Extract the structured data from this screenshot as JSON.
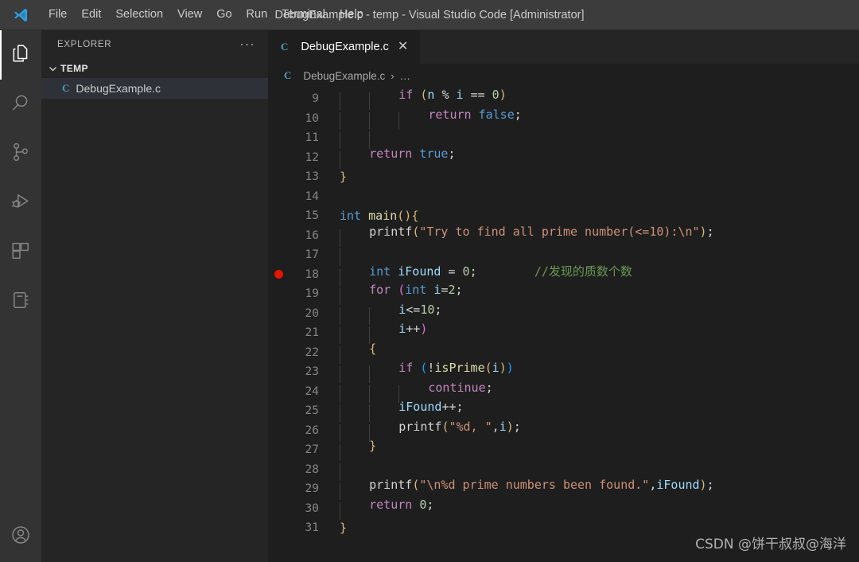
{
  "titlebar": {
    "logo_icon": "vscode-logo-icon",
    "window_title": "DebugExample.c - temp - Visual Studio Code [Administrator]",
    "menu": [
      {
        "label": "File"
      },
      {
        "label": "Edit"
      },
      {
        "label": "Selection"
      },
      {
        "label": "View"
      },
      {
        "label": "Go"
      },
      {
        "label": "Run"
      },
      {
        "label": "Terminal"
      },
      {
        "label": "Help"
      }
    ]
  },
  "activitybar": {
    "items": [
      {
        "icon": "files-explorer-icon",
        "label": "Explorer",
        "active": true
      },
      {
        "icon": "search-icon",
        "label": "Search",
        "active": false
      },
      {
        "icon": "source-control-icon",
        "label": "Source Control",
        "active": false
      },
      {
        "icon": "run-and-debug-icon",
        "label": "Run and Debug",
        "active": false
      },
      {
        "icon": "extensions-icon",
        "label": "Extensions",
        "active": false
      },
      {
        "icon": "notebook-icon",
        "label": "Notebook",
        "active": false
      }
    ],
    "bottom": [
      {
        "icon": "account-icon",
        "label": "Accounts"
      }
    ]
  },
  "sidebar": {
    "title": "EXPLORER",
    "more_actions": "···",
    "folder": {
      "label": "TEMP",
      "expanded": true
    },
    "files": [
      {
        "icon": "c-file-icon",
        "label": "DebugExample.c",
        "selected": true
      }
    ]
  },
  "editor": {
    "tabs": [
      {
        "icon": "c-file-icon",
        "label": "DebugExample.c",
        "close": "✕",
        "active": true
      }
    ],
    "breadcrumb": {
      "file_icon": "c-file-icon",
      "file": "DebugExample.c",
      "separator": "›",
      "overflow": "…"
    }
  },
  "code": {
    "first_visible_line": 9,
    "breakpoint_line": 18,
    "lines": [
      {
        "n": 9,
        "indent": 2,
        "tokens": [
          {
            "t": "if",
            "c": "t-key"
          },
          {
            "t": " ",
            "c": "t-plain"
          },
          {
            "t": "(",
            "c": "p-y"
          },
          {
            "t": "n",
            "c": "t-var"
          },
          {
            "t": " ",
            "c": "t-plain"
          },
          {
            "t": "%",
            "c": "t-plain"
          },
          {
            "t": " ",
            "c": "t-plain"
          },
          {
            "t": "i",
            "c": "t-var"
          },
          {
            "t": " ",
            "c": "t-plain"
          },
          {
            "t": "==",
            "c": "t-plain"
          },
          {
            "t": " ",
            "c": "t-plain"
          },
          {
            "t": "0",
            "c": "t-num"
          },
          {
            "t": ")",
            "c": "p-y"
          }
        ]
      },
      {
        "n": 10,
        "indent": 3,
        "tokens": [
          {
            "t": "return",
            "c": "t-key"
          },
          {
            "t": " ",
            "c": "t-plain"
          },
          {
            "t": "false",
            "c": "t-const"
          },
          {
            "t": ";",
            "c": "t-plain"
          }
        ]
      },
      {
        "n": 11,
        "indent": 2,
        "tokens": []
      },
      {
        "n": 12,
        "indent": 1,
        "tokens": [
          {
            "t": "return",
            "c": "t-key"
          },
          {
            "t": " ",
            "c": "t-plain"
          },
          {
            "t": "true",
            "c": "t-const"
          },
          {
            "t": ";",
            "c": "t-plain"
          }
        ]
      },
      {
        "n": 13,
        "indent": 0,
        "tokens": [
          {
            "t": "}",
            "c": "br-y"
          }
        ]
      },
      {
        "n": 14,
        "indent": 0,
        "tokens": []
      },
      {
        "n": 15,
        "indent": 0,
        "tokens": [
          {
            "t": "int",
            "c": "t-type"
          },
          {
            "t": " ",
            "c": "t-plain"
          },
          {
            "t": "main",
            "c": "t-fn"
          },
          {
            "t": "(",
            "c": "p-y"
          },
          {
            "t": ")",
            "c": "p-y"
          },
          {
            "t": "{",
            "c": "br-y"
          }
        ]
      },
      {
        "n": 16,
        "indent": 1,
        "tokens": [
          {
            "t": "printf",
            "c": "t-plain"
          },
          {
            "t": "(",
            "c": "p-y"
          },
          {
            "t": "\"Try to find all prime number(<=10):\\n\"",
            "c": "t-str"
          },
          {
            "t": ")",
            "c": "p-y"
          },
          {
            "t": ";",
            "c": "t-plain"
          }
        ]
      },
      {
        "n": 17,
        "indent": 1,
        "tokens": []
      },
      {
        "n": 18,
        "indent": 1,
        "tokens": [
          {
            "t": "int",
            "c": "t-type"
          },
          {
            "t": " ",
            "c": "t-plain"
          },
          {
            "t": "iFound",
            "c": "t-var"
          },
          {
            "t": " ",
            "c": "t-plain"
          },
          {
            "t": "=",
            "c": "t-plain"
          },
          {
            "t": " ",
            "c": "t-plain"
          },
          {
            "t": "0",
            "c": "t-num"
          },
          {
            "t": ";",
            "c": "t-plain"
          },
          {
            "t": "        ",
            "c": "t-plain"
          },
          {
            "t": "//发现的质数个数",
            "c": "t-cmt"
          }
        ]
      },
      {
        "n": 19,
        "indent": 1,
        "tokens": [
          {
            "t": "for",
            "c": "t-key"
          },
          {
            "t": " ",
            "c": "t-plain"
          },
          {
            "t": "(",
            "c": "p-m"
          },
          {
            "t": "int",
            "c": "t-type"
          },
          {
            "t": " ",
            "c": "t-plain"
          },
          {
            "t": "i",
            "c": "t-var"
          },
          {
            "t": "=",
            "c": "t-plain"
          },
          {
            "t": "2",
            "c": "t-num"
          },
          {
            "t": ";",
            "c": "t-plain"
          }
        ]
      },
      {
        "n": 20,
        "indent": 2,
        "tokens": [
          {
            "t": "i",
            "c": "t-var"
          },
          {
            "t": "<=",
            "c": "t-plain"
          },
          {
            "t": "10",
            "c": "t-num"
          },
          {
            "t": ";",
            "c": "t-plain"
          }
        ]
      },
      {
        "n": 21,
        "indent": 2,
        "tokens": [
          {
            "t": "i",
            "c": "t-var"
          },
          {
            "t": "++",
            "c": "t-plain"
          },
          {
            "t": ")",
            "c": "p-m"
          }
        ]
      },
      {
        "n": 22,
        "indent": 1,
        "tokens": [
          {
            "t": "{",
            "c": "br-y"
          }
        ]
      },
      {
        "n": 23,
        "indent": 2,
        "tokens": [
          {
            "t": "if",
            "c": "t-key"
          },
          {
            "t": " ",
            "c": "t-plain"
          },
          {
            "t": "(",
            "c": "p-b"
          },
          {
            "t": "!",
            "c": "t-plain"
          },
          {
            "t": "isPrime",
            "c": "t-fn"
          },
          {
            "t": "(",
            "c": "p-y"
          },
          {
            "t": "i",
            "c": "t-var"
          },
          {
            "t": ")",
            "c": "p-y"
          },
          {
            "t": ")",
            "c": "p-b"
          }
        ]
      },
      {
        "n": 24,
        "indent": 3,
        "tokens": [
          {
            "t": "continue",
            "c": "t-key"
          },
          {
            "t": ";",
            "c": "t-plain"
          }
        ]
      },
      {
        "n": 25,
        "indent": 2,
        "tokens": [
          {
            "t": "iFound",
            "c": "t-var"
          },
          {
            "t": "++",
            "c": "t-plain"
          },
          {
            "t": ";",
            "c": "t-plain"
          }
        ]
      },
      {
        "n": 26,
        "indent": 2,
        "tokens": [
          {
            "t": "printf",
            "c": "t-plain"
          },
          {
            "t": "(",
            "c": "p-y"
          },
          {
            "t": "\"%d, \"",
            "c": "t-str"
          },
          {
            "t": ",",
            "c": "t-plain"
          },
          {
            "t": "i",
            "c": "t-var"
          },
          {
            "t": ")",
            "c": "p-y"
          },
          {
            "t": ";",
            "c": "t-plain"
          }
        ]
      },
      {
        "n": 27,
        "indent": 1,
        "tokens": [
          {
            "t": "}",
            "c": "br-y"
          }
        ]
      },
      {
        "n": 28,
        "indent": 1,
        "tokens": []
      },
      {
        "n": 29,
        "indent": 1,
        "tokens": [
          {
            "t": "printf",
            "c": "t-plain"
          },
          {
            "t": "(",
            "c": "p-y"
          },
          {
            "t": "\"\\n%d prime numbers been found.\"",
            "c": "t-str"
          },
          {
            "t": ",",
            "c": "t-plain"
          },
          {
            "t": "iFound",
            "c": "t-var"
          },
          {
            "t": ")",
            "c": "p-y"
          },
          {
            "t": ";",
            "c": "t-plain"
          }
        ]
      },
      {
        "n": 30,
        "indent": 1,
        "tokens": [
          {
            "t": "return",
            "c": "t-key"
          },
          {
            "t": " ",
            "c": "t-plain"
          },
          {
            "t": "0",
            "c": "t-num"
          },
          {
            "t": ";",
            "c": "t-plain"
          }
        ]
      },
      {
        "n": 31,
        "indent": 0,
        "tokens": [
          {
            "t": "}",
            "c": "br-y"
          }
        ]
      }
    ]
  },
  "watermark": {
    "text": "CSDN @饼干叔叔@海洋"
  },
  "colors": {
    "titlebar_bg": "#3c3c3c",
    "activitybar_bg": "#333333",
    "sidebar_bg": "#252526",
    "editor_bg": "#1e1e1e",
    "breakpoint_red": "#e51400",
    "selected_row_bg": "#2f3139",
    "c_icon_blue": "#519aba"
  }
}
